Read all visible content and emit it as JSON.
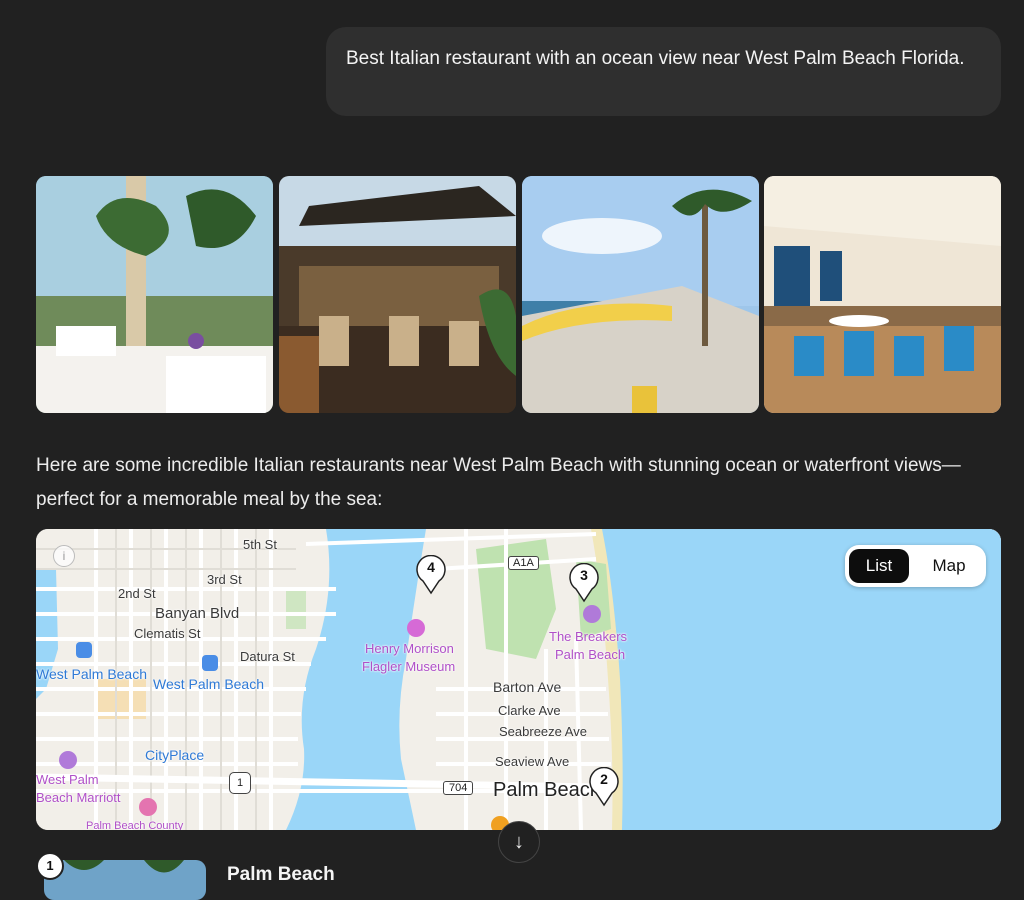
{
  "user_message": "Best Italian restaurant with an ocean view near West Palm Beach Florida.",
  "reply_intro": "Here are some incredible Italian restaurants near West Palm Beach with stunning ocean or waterfront views—perfect for a memorable meal by the sea:",
  "map": {
    "toggle": {
      "list_label": "List",
      "map_label": "Map",
      "selected": "List"
    },
    "info_icon": "i",
    "street_labels": [
      "5th St",
      "3rd St",
      "2nd St",
      "Banyan Blvd",
      "Clematis St",
      "Datura St",
      "Barton Ave",
      "Clarke Ave",
      "Seabreeze Ave",
      "Seaview Ave"
    ],
    "place_labels": {
      "west_palm_beach_station": "West Palm Beach",
      "west_palm_beach": "West Palm Beach",
      "cityplace": "CityPlace",
      "marriott": [
        "West Palm",
        "Beach Marriott"
      ],
      "flagler_museum": [
        "Henry Morrison",
        "Flagler Museum"
      ],
      "breakers": [
        "The Breakers",
        "Palm Beach"
      ],
      "palm_beach": "Palm Beach",
      "palm_beach_county": "Palm Beach County"
    },
    "road_shields": {
      "a1a": "A1A",
      "r704": "704",
      "us1": "1"
    },
    "pins": [
      {
        "number": "4"
      },
      {
        "number": "3"
      },
      {
        "number": "2"
      }
    ]
  },
  "scroll_down_icon": "↓",
  "results": [
    {
      "number": "1",
      "title": "Palm Beach"
    }
  ]
}
